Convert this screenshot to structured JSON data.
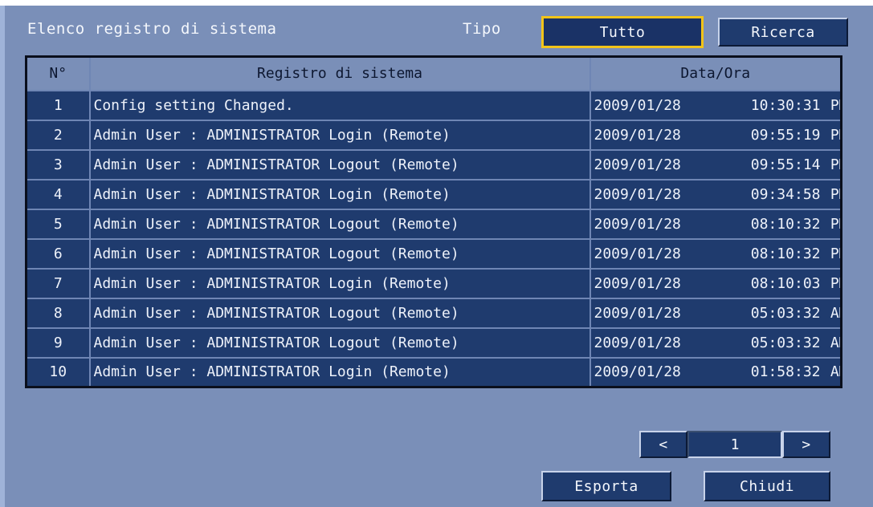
{
  "header": {
    "title": "Elenco registro di sistema",
    "type_label": "Tipo",
    "type_value": "Tutto",
    "search_label": "Ricerca"
  },
  "table": {
    "columns": [
      "N°",
      "Registro di sistema",
      "Data/Ora"
    ],
    "rows": [
      {
        "n": "1",
        "msg": "Config setting Changed.",
        "date": "2009/01/28",
        "time": "10:30:31",
        "ampm": "PM"
      },
      {
        "n": "2",
        "msg": "Admin User : ADMINISTRATOR Login (Remote)",
        "date": "2009/01/28",
        "time": "09:55:19",
        "ampm": "PM"
      },
      {
        "n": "3",
        "msg": "Admin User : ADMINISTRATOR Logout (Remote)",
        "date": "2009/01/28",
        "time": "09:55:14",
        "ampm": "PM"
      },
      {
        "n": "4",
        "msg": "Admin User : ADMINISTRATOR Login (Remote)",
        "date": "2009/01/28",
        "time": "09:34:58",
        "ampm": "PM"
      },
      {
        "n": "5",
        "msg": "Admin User : ADMINISTRATOR Logout (Remote)",
        "date": "2009/01/28",
        "time": "08:10:32",
        "ampm": "PM"
      },
      {
        "n": "6",
        "msg": "Admin User : ADMINISTRATOR Logout (Remote)",
        "date": "2009/01/28",
        "time": "08:10:32",
        "ampm": "PM"
      },
      {
        "n": "7",
        "msg": "Admin User : ADMINISTRATOR Login (Remote)",
        "date": "2009/01/28",
        "time": "08:10:03",
        "ampm": "PM"
      },
      {
        "n": "8",
        "msg": "Admin User : ADMINISTRATOR Logout (Remote)",
        "date": "2009/01/28",
        "time": "05:03:32",
        "ampm": "AM"
      },
      {
        "n": "9",
        "msg": "Admin User : ADMINISTRATOR Logout (Remote)",
        "date": "2009/01/28",
        "time": "05:03:32",
        "ampm": "AM"
      },
      {
        "n": "10",
        "msg": "Admin User : ADMINISTRATOR Login (Remote)",
        "date": "2009/01/28",
        "time": "01:58:32",
        "ampm": "AM"
      }
    ]
  },
  "pagination": {
    "prev_label": "<",
    "page": "1",
    "next_label": ">"
  },
  "footer": {
    "export_label": "Esporta",
    "close_label": "Chiudi"
  },
  "colors": {
    "panel": "#7a8fb8",
    "row": "#1f3b6e",
    "selected_border": "#f2c419"
  }
}
